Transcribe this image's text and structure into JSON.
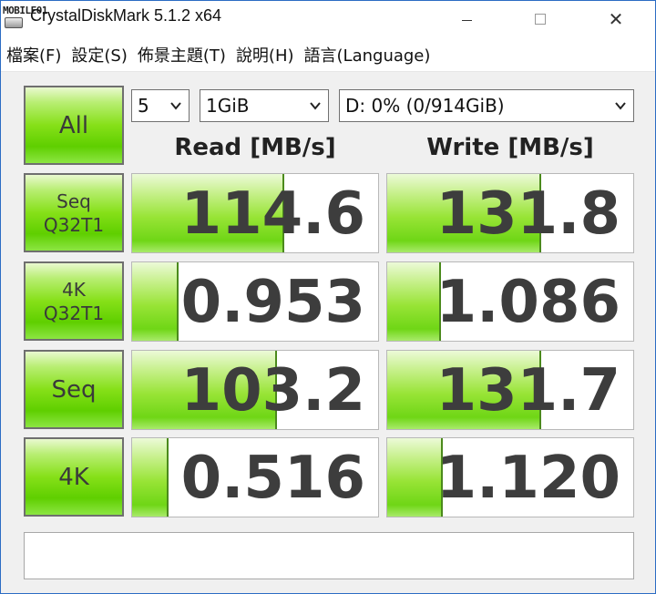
{
  "titlebar": {
    "logo_text": "MOBILE01",
    "title": "CrystalDiskMark 5.1.2 x64",
    "close_glyph": "✕"
  },
  "menu": {
    "items": [
      "檔案(F)",
      "設定(S)",
      "佈景主題(T)",
      "說明(H)",
      "語言(Language)"
    ]
  },
  "controls": {
    "all_label": "All",
    "test_count": "5",
    "test_size": "1GiB",
    "drive": "D: 0% (0/914GiB)"
  },
  "headers": {
    "read": "Read [MB/s]",
    "write": "Write [MB/s]"
  },
  "rows": [
    {
      "line1": "Seq",
      "line2": "Q32T1",
      "read": "114.6",
      "write": "131.8",
      "read_fill": 0.61,
      "write_fill": 0.62
    },
    {
      "line1": "4K",
      "line2": "Q32T1",
      "read": "0.953",
      "write": "1.086",
      "read_fill": 0.18,
      "write_fill": 0.21
    },
    {
      "line1": "Seq",
      "line2": "",
      "read": "103.2",
      "write": "131.7",
      "read_fill": 0.58,
      "write_fill": 0.62
    },
    {
      "line1": "4K",
      "line2": "",
      "read": "0.516",
      "write": "1.120",
      "read_fill": 0.14,
      "write_fill": 0.22
    }
  ],
  "comment": "",
  "colors": {
    "bar_green": "#98e436",
    "button_green": "#86e018",
    "value_text": "#3d3d3d",
    "window_border": "#2b6cc4"
  }
}
